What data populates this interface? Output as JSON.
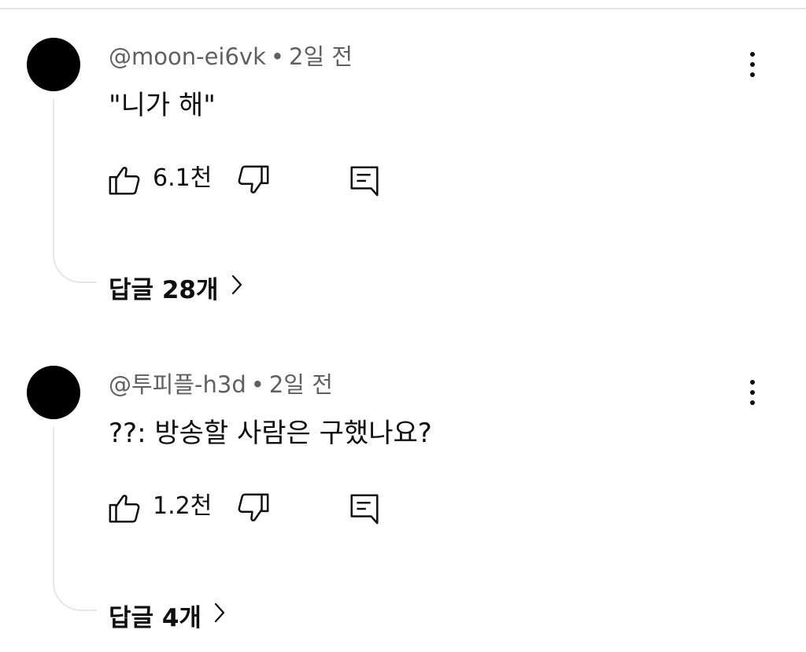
{
  "comments": [
    {
      "author": "@moon-ei6vk",
      "time": "2일 전",
      "text": "\"니가 해\"",
      "likes": "6.1천",
      "replies_label": "답글 28개"
    },
    {
      "author": "@투피플-h3d",
      "time": "2일 전",
      "text": "??: 방송할 사람은 구했나요?",
      "likes": "1.2천",
      "replies_label": "답글 4개"
    }
  ],
  "separator": "•",
  "icons": {
    "avatar": "avatar",
    "more": "more-vert-icon",
    "like": "thumb-up-icon",
    "dislike": "thumb-down-icon",
    "reply": "reply-comment-icon",
    "chevron": "chevron-right-icon"
  },
  "colors": {
    "avatar": "#000000",
    "meta_text": "#606060",
    "text": "#0f0f0f",
    "thread_line": "#e6e6e6"
  }
}
